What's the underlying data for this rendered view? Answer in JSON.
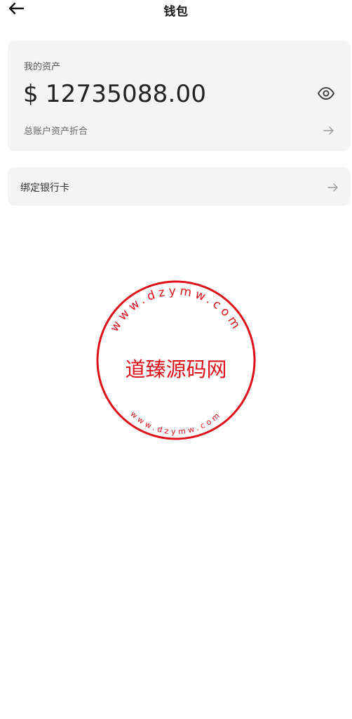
{
  "header": {
    "title": "钱包",
    "back_icon": "arrow-left-icon"
  },
  "asset_card": {
    "label": "我的资产",
    "currency": "$",
    "amount": "12735088.00",
    "visibility_icon": "eye-icon",
    "sub_label": "总账户资产折合",
    "arrow_icon": "arrow-right-icon"
  },
  "bank_card_row": {
    "label": "绑定银行卡",
    "arrow_icon": "arrow-right-icon"
  },
  "stamp": {
    "text": "道臻源码网",
    "top_ring": "www.dzymw.com",
    "bottom_ring": "www.dzymw.com",
    "color": "#e0101a"
  },
  "colors": {
    "card_bg": "#f4f4f4",
    "text_primary": "#1a1a1a",
    "text_secondary": "#666666",
    "stamp_red": "#e0101a"
  }
}
